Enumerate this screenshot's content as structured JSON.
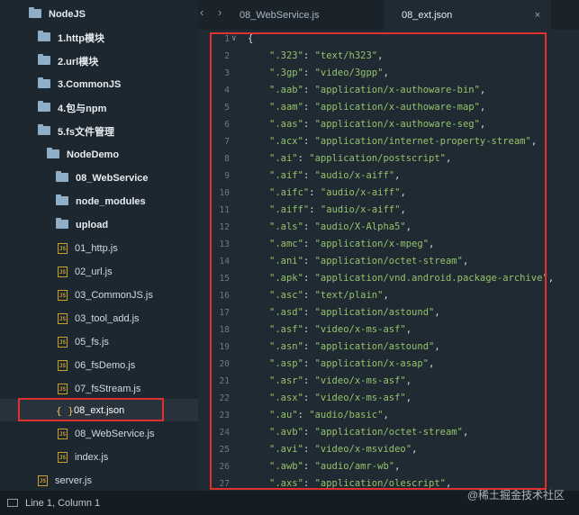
{
  "sidebar": {
    "items": [
      {
        "label": "NodeJS",
        "type": "folder",
        "bold": true
      },
      {
        "label": "1.http模块",
        "type": "folder",
        "bold": true
      },
      {
        "label": "2.url模块",
        "type": "folder",
        "bold": true
      },
      {
        "label": "3.CommonJS",
        "type": "folder",
        "bold": true
      },
      {
        "label": "4.包与npm",
        "type": "folder",
        "bold": true
      },
      {
        "label": "5.fs文件管理",
        "type": "folder",
        "bold": true
      },
      {
        "label": "NodeDemo",
        "type": "folder",
        "bold": true
      },
      {
        "label": "08_WebService",
        "type": "folder",
        "bold": true
      },
      {
        "label": "node_modules",
        "type": "folder",
        "bold": true
      },
      {
        "label": "upload",
        "type": "folder",
        "bold": true
      },
      {
        "label": "01_http.js",
        "type": "js"
      },
      {
        "label": "02_url.js",
        "type": "js"
      },
      {
        "label": "03_CommonJS.js",
        "type": "js"
      },
      {
        "label": "03_tool_add.js",
        "type": "js"
      },
      {
        "label": "05_fs.js",
        "type": "js"
      },
      {
        "label": "06_fsDemo.js",
        "type": "js"
      },
      {
        "label": "07_fsStream.js",
        "type": "js"
      },
      {
        "label": "08_ext.json",
        "type": "json",
        "selected": true
      },
      {
        "label": "08_WebService.js",
        "type": "js"
      },
      {
        "label": "index.js",
        "type": "js"
      },
      {
        "label": "server.js",
        "type": "js"
      }
    ]
  },
  "tabs": {
    "nav": "‹ ›",
    "items": [
      {
        "label": "08_WebService.js",
        "active": false
      },
      {
        "label": "08_ext.json",
        "active": true
      }
    ],
    "close": "×"
  },
  "editor": {
    "lines": [
      {
        "n": "1",
        "text": "{"
      },
      {
        "n": "2",
        "key": "\".323\"",
        "value": "\"text/h323\""
      },
      {
        "n": "3",
        "key": "\".3gp\"",
        "value": "\"video/3gpp\""
      },
      {
        "n": "4",
        "key": "\".aab\"",
        "value": "\"application/x-authoware-bin\""
      },
      {
        "n": "5",
        "key": "\".aam\"",
        "value": "\"application/x-authoware-map\""
      },
      {
        "n": "6",
        "key": "\".aas\"",
        "value": "\"application/x-authoware-seg\""
      },
      {
        "n": "7",
        "key": "\".acx\"",
        "value": "\"application/internet-property-stream\""
      },
      {
        "n": "8",
        "key": "\".ai\"",
        "value": "\"application/postscript\""
      },
      {
        "n": "9",
        "key": "\".aif\"",
        "value": "\"audio/x-aiff\""
      },
      {
        "n": "10",
        "key": "\".aifc\"",
        "value": "\"audio/x-aiff\""
      },
      {
        "n": "11",
        "key": "\".aiff\"",
        "value": "\"audio/x-aiff\""
      },
      {
        "n": "12",
        "key": "\".als\"",
        "value": "\"audio/X-Alpha5\""
      },
      {
        "n": "13",
        "key": "\".amc\"",
        "value": "\"application/x-mpeg\""
      },
      {
        "n": "14",
        "key": "\".ani\"",
        "value": "\"application/octet-stream\""
      },
      {
        "n": "15",
        "key": "\".apk\"",
        "value": "\"application/vnd.android.package-archive\""
      },
      {
        "n": "16",
        "key": "\".asc\"",
        "value": "\"text/plain\""
      },
      {
        "n": "17",
        "key": "\".asd\"",
        "value": "\"application/astound\""
      },
      {
        "n": "18",
        "key": "\".asf\"",
        "value": "\"video/x-ms-asf\""
      },
      {
        "n": "19",
        "key": "\".asn\"",
        "value": "\"application/astound\""
      },
      {
        "n": "20",
        "key": "\".asp\"",
        "value": "\"application/x-asap\""
      },
      {
        "n": "21",
        "key": "\".asr\"",
        "value": "\"video/x-ms-asf\""
      },
      {
        "n": "22",
        "key": "\".asx\"",
        "value": "\"video/x-ms-asf\""
      },
      {
        "n": "23",
        "key": "\".au\"",
        "value": "\"audio/basic\""
      },
      {
        "n": "24",
        "key": "\".avb\"",
        "value": "\"application/octet-stream\""
      },
      {
        "n": "25",
        "key": "\".avi\"",
        "value": "\"video/x-msvideo\""
      },
      {
        "n": "26",
        "key": "\".awb\"",
        "value": "\"audio/amr-wb\""
      },
      {
        "n": "27",
        "key": "\".axs\"",
        "value": "\"application/olescript\""
      }
    ]
  },
  "status": {
    "position": "Line 1, Column 1"
  },
  "watermark": "@稀土掘金技术社区",
  "colors": {
    "highlight_border": "#e03030",
    "string_green": "#95c36b",
    "folder_blue": "#8faec7",
    "js_yellow": "#c9a227"
  }
}
